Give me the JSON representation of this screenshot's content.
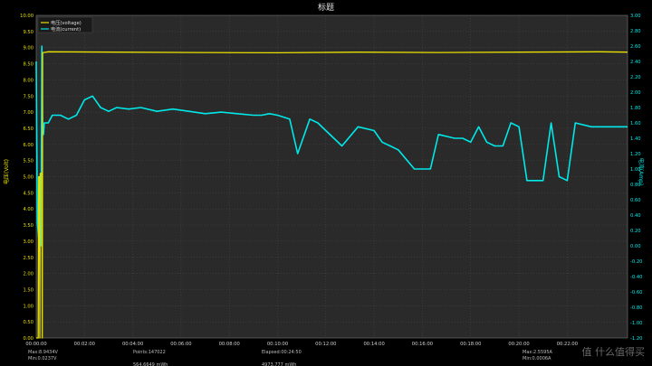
{
  "chart_data": {
    "type": "line",
    "title": "标题",
    "ylabel_left": "电压(Volt)",
    "ylabel_right": "电流(Amp)",
    "colors": {
      "voltage": "#e8e000",
      "current": "#00e8e8",
      "background": "#2a2a2a",
      "grid": "#555555"
    },
    "legend_position": "top-left",
    "grid": true,
    "y_left": {
      "range": [
        0,
        10
      ],
      "ticks": [
        "0.00",
        "0.50",
        "1.00",
        "1.50",
        "2.00",
        "2.50",
        "3.00",
        "3.50",
        "4.00",
        "4.50",
        "5.00",
        "5.50",
        "6.00",
        "6.50",
        "7.00",
        "7.50",
        "8.00",
        "8.50",
        "9.00",
        "9.50",
        "10.00"
      ]
    },
    "y_right": {
      "range": [
        -1.2,
        3.0
      ],
      "ticks": [
        "-1.20",
        "-1.00",
        "-0.80",
        "-0.60",
        "-0.40",
        "-0.20",
        "0.00",
        "0.20",
        "0.40",
        "0.60",
        "0.80",
        "1.00",
        "1.20",
        "1.40",
        "1.60",
        "1.80",
        "2.00",
        "2.20",
        "2.40",
        "2.60",
        "2.80",
        "3.00"
      ]
    },
    "x_axis": {
      "range_seconds": [
        0,
        1470
      ],
      "ticks": [
        "00:00:00",
        "00:02:00",
        "00:04:00",
        "00:06:00",
        "00:08:00",
        "00:10:00",
        "00:12:00",
        "00:14:00",
        "00:16:00",
        "00:18:00",
        "00:20:00",
        "00:22:00"
      ]
    },
    "series": [
      {
        "name": "电压(voltage)",
        "axis": "left",
        "x_seconds": [
          0,
          5,
          6,
          8,
          9,
          10,
          11,
          14,
          15,
          16,
          18,
          19,
          30,
          200,
          400,
          600,
          800,
          1000,
          1200,
          1400,
          1470
        ],
        "values": [
          0.0,
          0.0,
          5.0,
          5.0,
          0.0,
          5.1,
          5.1,
          5.1,
          0.0,
          8.85,
          8.85,
          8.85,
          8.87,
          8.86,
          8.85,
          8.84,
          8.86,
          8.85,
          8.86,
          8.87,
          8.86
        ]
      },
      {
        "name": "电流(current)",
        "axis": "right",
        "x_seconds": [
          0,
          3,
          6,
          9,
          12,
          14,
          16,
          18,
          20,
          30,
          40,
          60,
          80,
          100,
          120,
          140,
          160,
          180,
          200,
          230,
          260,
          300,
          340,
          380,
          420,
          460,
          500,
          540,
          560,
          580,
          600,
          630,
          650,
          680,
          700,
          720,
          760,
          800,
          840,
          860,
          880,
          900,
          940,
          980,
          1000,
          1040,
          1060,
          1080,
          1100,
          1120,
          1140,
          1160,
          1180,
          1200,
          1220,
          1240,
          1260,
          1280,
          1300,
          1320,
          1340,
          1380,
          1420,
          1450,
          1460,
          1470
        ],
        "values": [
          2.4,
          0.3,
          0.1,
          0.3,
          0.0,
          2.6,
          1.5,
          1.45,
          1.6,
          1.6,
          1.7,
          1.7,
          1.65,
          1.7,
          1.9,
          1.95,
          1.8,
          1.75,
          1.8,
          1.78,
          1.8,
          1.75,
          1.78,
          1.75,
          1.72,
          1.74,
          1.72,
          1.7,
          1.7,
          1.72,
          1.7,
          1.65,
          1.2,
          1.65,
          1.6,
          1.5,
          1.3,
          1.55,
          1.5,
          1.35,
          1.3,
          1.25,
          1.0,
          1.0,
          1.45,
          1.4,
          1.4,
          1.35,
          1.55,
          1.35,
          1.3,
          1.3,
          1.6,
          1.55,
          0.85,
          0.85,
          0.85,
          1.6,
          0.9,
          0.85,
          1.6,
          1.55,
          1.55,
          1.55,
          1.55,
          1.55
        ]
      }
    ]
  },
  "footer": {
    "col1": [
      "Max:8.9434V",
      "Min:0.0237V"
    ],
    "col2": [
      "Points:147022",
      "",
      "564.6649 mWh"
    ],
    "col3": [
      "Elapsed:00:24:50",
      "",
      "4973.777 mWh"
    ],
    "col4": [
      "Max:2.5595A",
      "Min:0.0006A"
    ]
  },
  "watermark": "值 什么值得买"
}
